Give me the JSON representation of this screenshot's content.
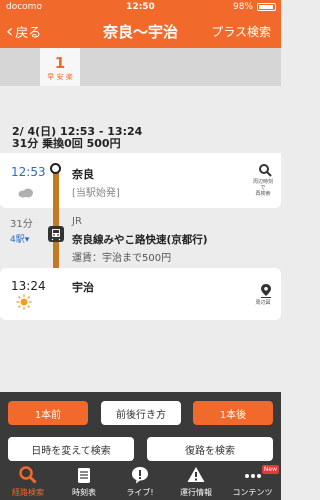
{
  "status_bar": {
    "carrier": "docomo",
    "time": "12:50",
    "battery": "98%"
  },
  "nav": {
    "back_label": "戻る",
    "title": "奈良〜宇治",
    "plus_search": "プラス検索"
  },
  "route_tab": {
    "number": "1",
    "label": "早 安 楽"
  },
  "summary": {
    "line1": "2/ 4(日) 12:53 - 13:24",
    "line2": "31分 乗換0回 500円"
  },
  "departure": {
    "time": "12:53",
    "station": "奈良",
    "note": "[当駅始発]",
    "icon_label_1": "周辺時刻で",
    "icon_label_2": "再検索"
  },
  "segment": {
    "duration": "31分",
    "stops": "4駅",
    "operator": "JR",
    "train_name": "奈良線みやこ路快速(京都行)",
    "fare": "運賃：宇治まで500円"
  },
  "arrival": {
    "time": "13:24",
    "station": "宇治",
    "icon_label": "周辺図"
  },
  "actions": {
    "prev": "1本前",
    "around": "前後行き方",
    "next": "1本後",
    "change_time": "日時を変えて検索",
    "return_route": "復路を検索"
  },
  "tabbar": {
    "items": [
      "経路検索",
      "時刻表",
      "ライブ!",
      "運行情報",
      "コンテンツ"
    ],
    "new_badge": "New"
  },
  "colors": {
    "accent": "#f26a2b",
    "line": "#c47a1e",
    "dark": "#3a3a3a"
  }
}
